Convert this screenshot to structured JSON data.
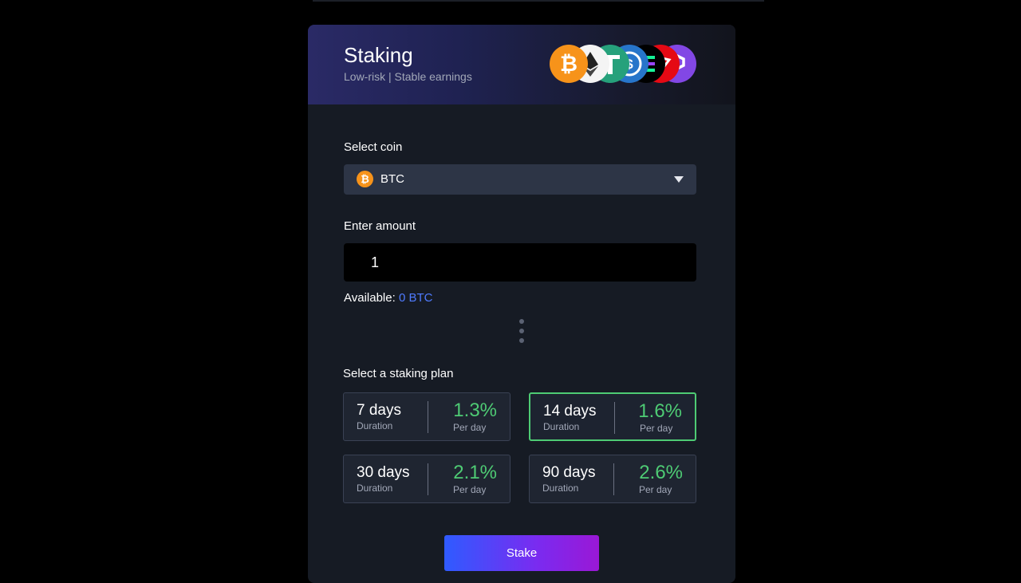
{
  "header": {
    "title": "Staking",
    "subtitle": "Low-risk | Stable earnings",
    "coins": [
      "bitcoin-icon",
      "ethereum-icon",
      "tether-icon",
      "usdc-icon",
      "solana-icon",
      "tron-icon",
      "polygon-icon"
    ]
  },
  "coin_select": {
    "label": "Select coin",
    "selected": "BTC",
    "icon": "bitcoin-icon"
  },
  "amount": {
    "label": "Enter amount",
    "value": "1",
    "available_label": "Available:",
    "available_value": "0 BTC"
  },
  "plans": {
    "label": "Select a staking plan",
    "items": [
      {
        "days": "7 days",
        "duration_label": "Duration",
        "rate": "1.3%",
        "rate_label": "Per day",
        "selected": false
      },
      {
        "days": "14 days",
        "duration_label": "Duration",
        "rate": "1.6%",
        "rate_label": "Per day",
        "selected": true
      },
      {
        "days": "30 days",
        "duration_label": "Duration",
        "rate": "2.1%",
        "rate_label": "Per day",
        "selected": false
      },
      {
        "days": "90 days",
        "duration_label": "Duration",
        "rate": "2.6%",
        "rate_label": "Per day",
        "selected": false
      }
    ]
  },
  "stake_button": "Stake",
  "colors": {
    "accent_green": "#4ecb74",
    "accent_blue": "#4f7bff",
    "btc_orange": "#f7931a"
  }
}
